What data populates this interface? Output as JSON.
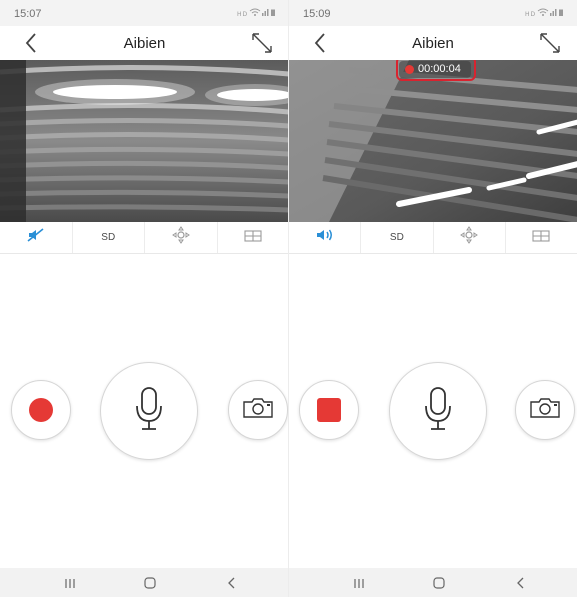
{
  "screens": [
    {
      "status": {
        "time": "15:07"
      },
      "title": "Aibien",
      "controls": {
        "audio_icon": "speaker-muted-icon",
        "quality_label": "SD",
        "ptz_icon": "ptz-direction-icon",
        "layout_icon": "grid-layout-icon"
      },
      "recording": {
        "active": false
      },
      "buttons": {
        "record_icon": "record-dot-icon",
        "talk_icon": "microphone-icon",
        "snapshot_icon": "camera-icon"
      }
    },
    {
      "status": {
        "time": "15:09"
      },
      "title": "Aibien",
      "controls": {
        "audio_icon": "speaker-on-icon",
        "quality_label": "SD",
        "ptz_icon": "ptz-direction-icon",
        "layout_icon": "grid-layout-icon"
      },
      "recording": {
        "active": true,
        "timer": "00:00:04"
      },
      "buttons": {
        "record_icon": "stop-square-icon",
        "talk_icon": "microphone-icon",
        "snapshot_icon": "camera-icon"
      }
    }
  ],
  "colors": {
    "accent": "#2a8fd6",
    "record_red": "#e53935",
    "highlight_outline": "#d9232f"
  }
}
